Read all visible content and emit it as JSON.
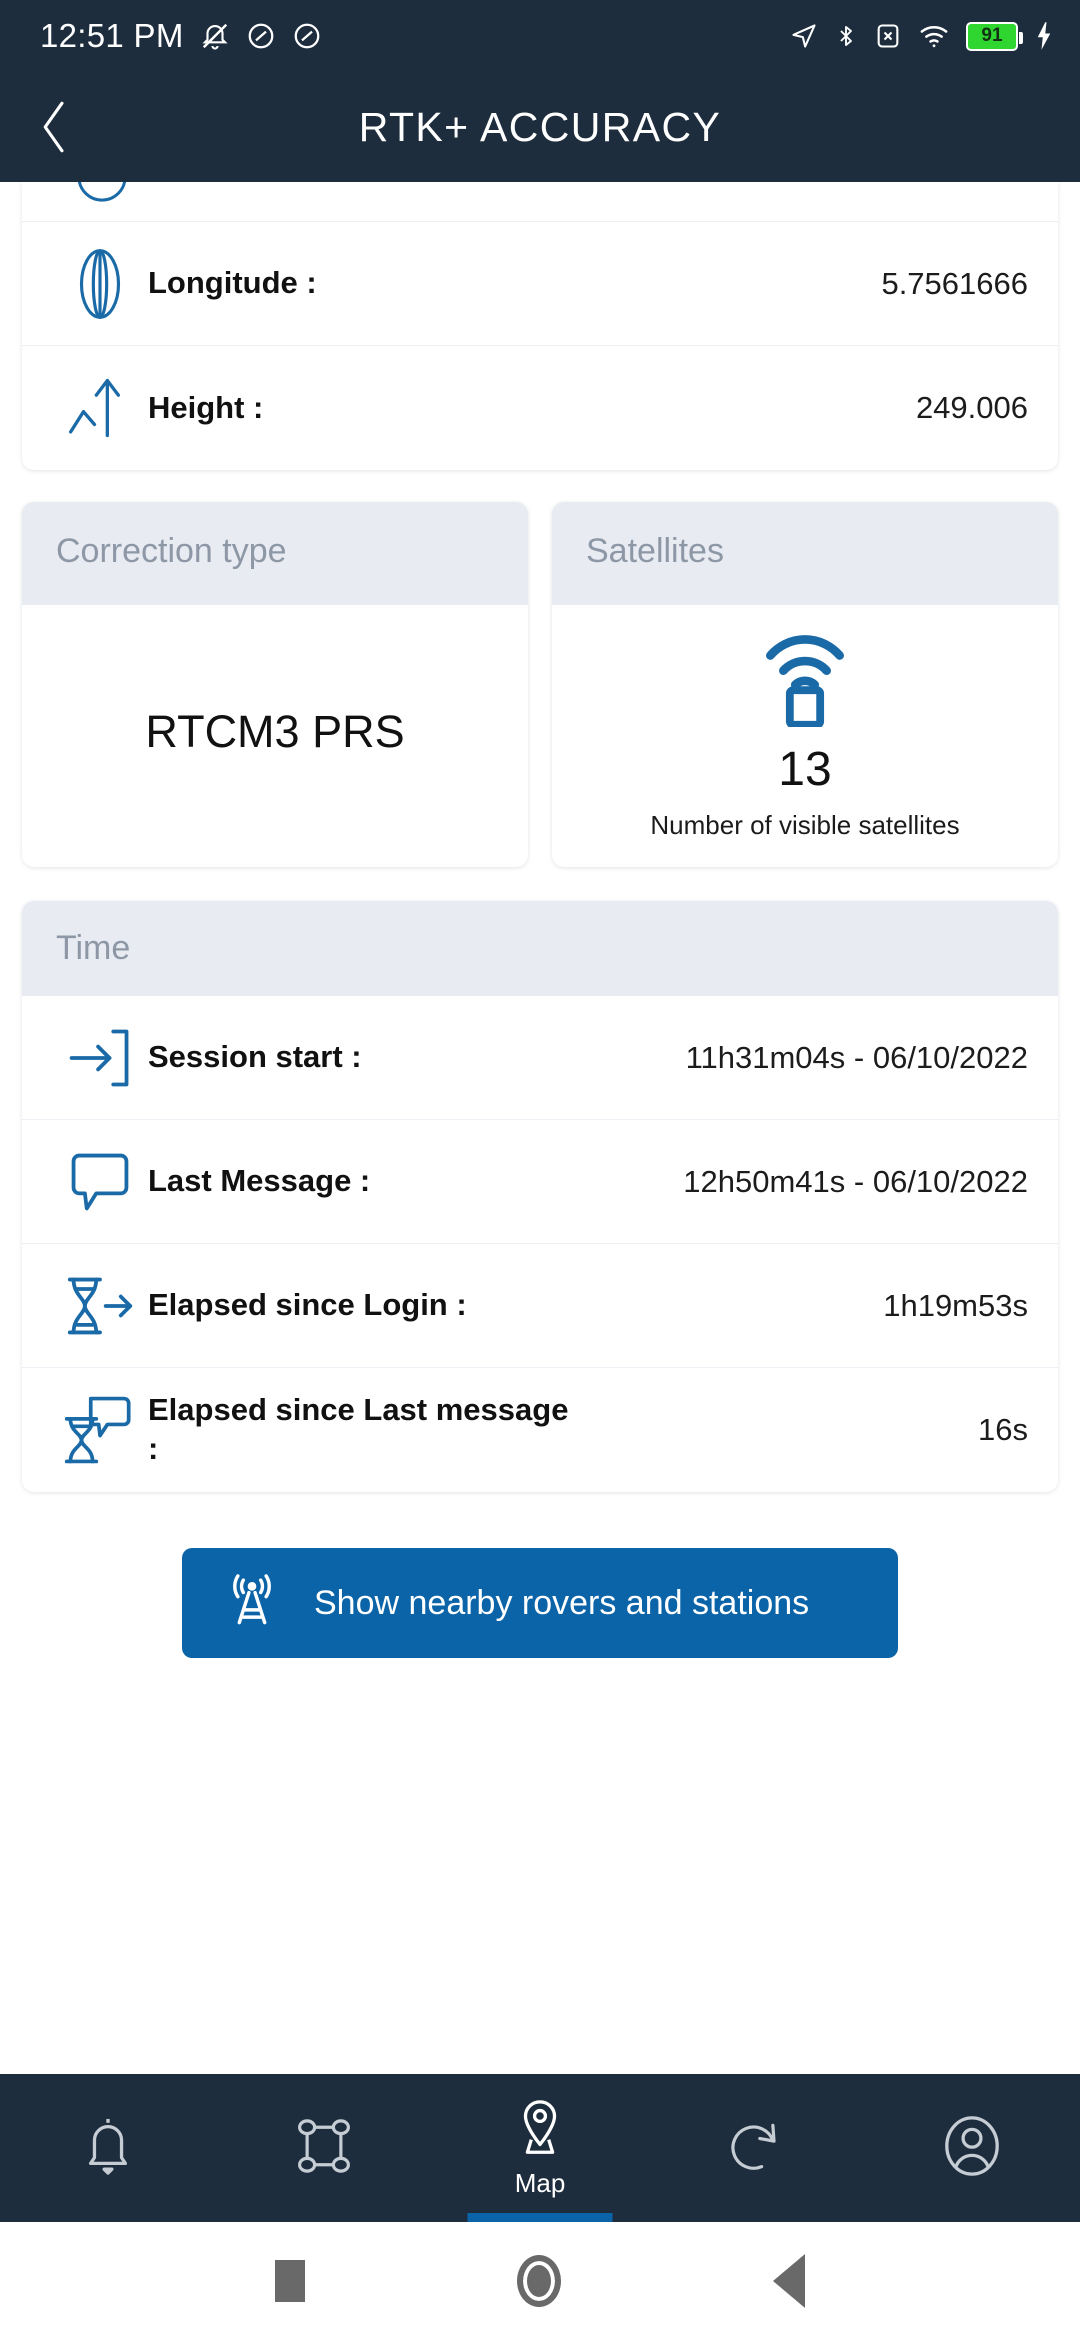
{
  "status_bar": {
    "time": "12:51 PM",
    "left_icons": [
      "mute-bell-icon",
      "dnd-icon",
      "dnd-icon"
    ],
    "right_icons": [
      "location-arrow-icon",
      "bluetooth-icon",
      "sim-card-x-icon",
      "wifi-icon"
    ],
    "battery_percent": "91",
    "battery_charging": true
  },
  "app_bar": {
    "back_label": "Back",
    "title": "RTK+ ACCURACY"
  },
  "position_card": {
    "rows": [
      {
        "icon": "meridian-globe-icon",
        "label": "Longitude :",
        "value": "5.7561666"
      },
      {
        "icon": "elevation-arrow-icon",
        "label": "Height :",
        "value": "249.006"
      }
    ]
  },
  "correction_card": {
    "header": "Correction type",
    "value": "RTCM3 PRS"
  },
  "satellites_card": {
    "header": "Satellites",
    "icon": "satellite-receiver-icon",
    "count": "13",
    "caption": "Number of visible satellites"
  },
  "time_card": {
    "header": "Time",
    "rows": [
      {
        "icon": "login-arrow-icon",
        "label": "Session start :",
        "value": "11h31m04s - 06/10/2022"
      },
      {
        "icon": "message-bubble-icon",
        "label": "Last Message :",
        "value": "12h50m41s - 06/10/2022"
      },
      {
        "icon": "hourglass-arrow-icon",
        "label": "Elapsed since Login :",
        "value": "1h19m53s"
      },
      {
        "icon": "hourglass-message-icon",
        "label": "Elapsed since Last message :",
        "value": "16s"
      }
    ]
  },
  "cta": {
    "icon": "broadcast-tower-icon",
    "label": "Show nearby rovers and stations"
  },
  "bottom_nav": {
    "items": [
      {
        "icon": "bell-icon",
        "label": "",
        "active": false
      },
      {
        "icon": "survey-polygon-icon",
        "label": "",
        "active": false
      },
      {
        "icon": "map-pin-icon",
        "label": "Map",
        "active": true
      },
      {
        "icon": "history-rotate-icon",
        "label": "",
        "active": false
      },
      {
        "icon": "user-profile-icon",
        "label": "",
        "active": false
      }
    ]
  },
  "system_nav": {
    "recents_label": "Recents",
    "home_label": "Home",
    "back_label": "Back"
  },
  "colors": {
    "header_bg": "#1e2d3d",
    "accent_blue": "#0b64a8",
    "icon_blue": "#1a6aa8",
    "card_header_bg": "#e8ecf2",
    "battery_green": "#2fd62f"
  }
}
